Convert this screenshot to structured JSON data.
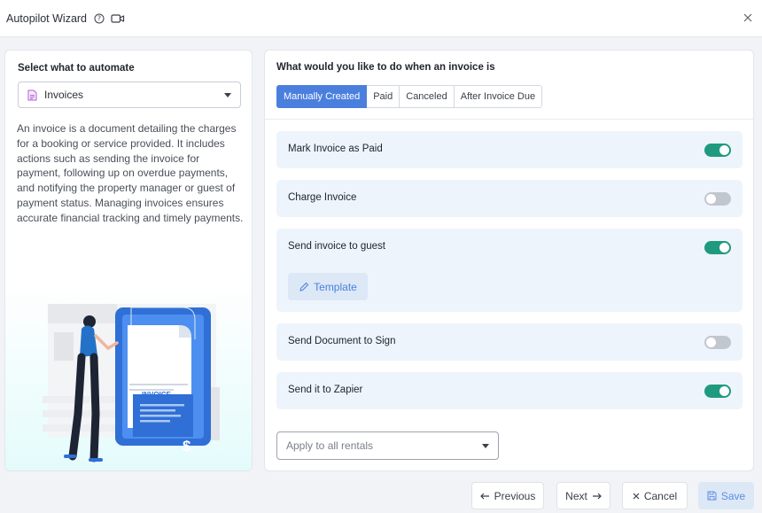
{
  "window": {
    "title": "Autopilot Wizard",
    "help_icon": "help-circle-icon",
    "video_icon": "video-camera-icon",
    "close_icon": "close-icon"
  },
  "left": {
    "label": "Select what to automate",
    "select_value": "Invoices",
    "select_icon": "document-icon",
    "description": "An invoice is a document detailing the charges for a booking or service provided. It includes actions such as sending the invoice for payment, following up on overdue payments, and notifying the property manager or guest of payment status. Managing invoices ensures accurate financial tracking and timely payments.",
    "illustration_text": "INVOICE",
    "illustration_symbol": "$"
  },
  "right": {
    "question": "What would you like to do when an invoice is",
    "tabs": [
      {
        "label": "Manually Created",
        "active": true
      },
      {
        "label": "Paid",
        "active": false
      },
      {
        "label": "Canceled",
        "active": false
      },
      {
        "label": "After Invoice Due",
        "active": false
      }
    ],
    "actions": [
      {
        "label": "Mark Invoice as Paid",
        "enabled": true
      },
      {
        "label": "Charge Invoice",
        "enabled": false
      },
      {
        "label": "Send invoice to guest",
        "enabled": true
      },
      {
        "label": "Send Document to Sign",
        "enabled": false
      },
      {
        "label": "Send it to Zapier",
        "enabled": true
      }
    ],
    "template_button": "Template",
    "rentals_placeholder": "Apply to all rentals"
  },
  "footer": {
    "previous": "Previous",
    "next": "Next",
    "cancel": "Cancel",
    "save": "Save"
  },
  "colors": {
    "accent": "#4a7fde",
    "toggle_on": "#1f9a80",
    "toggle_off": "#c2c6ce",
    "action_bg": "#eef4fb"
  }
}
